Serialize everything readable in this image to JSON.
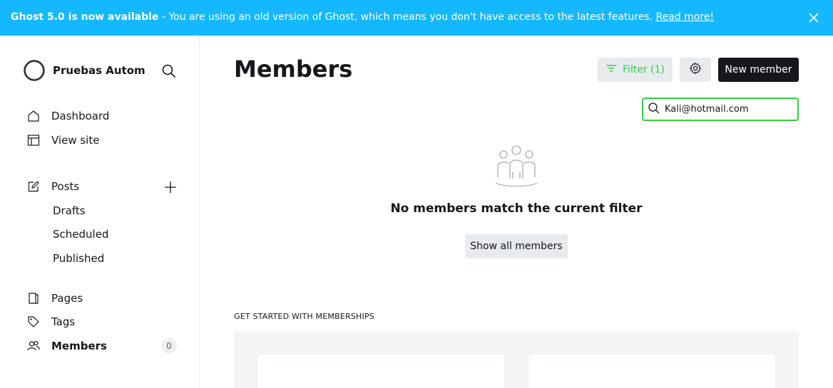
{
  "banner": {
    "bold_text": "Ghost 5.0 is now available",
    "text": " - You are using an old version of Ghost, which means you don't have access to the latest features. ",
    "link_text": "Read more!"
  },
  "sidebar": {
    "site_title": "Pruebas Autom...",
    "nav": {
      "dashboard": "Dashboard",
      "view_site": "View site",
      "posts": "Posts",
      "drafts": "Drafts",
      "scheduled": "Scheduled",
      "published": "Published",
      "pages": "Pages",
      "tags": "Tags",
      "members": "Members",
      "members_count": "0"
    }
  },
  "main": {
    "title": "Members",
    "filter_label": "Filter (1)",
    "new_member_label": "New member",
    "search_value": "Kali@hotmail.com",
    "empty_title": "No members match the current filter",
    "show_all_label": "Show all members",
    "get_started_label": "GET STARTED WITH MEMBERSHIPS"
  },
  "colors": {
    "banner_bg": "#14b8ff",
    "accent_green": "#30cf43",
    "primary_dark": "#15171a"
  },
  "icons": [
    "close-icon",
    "site-logo-icon",
    "search-icon",
    "home-icon",
    "view-site-icon",
    "posts-icon",
    "plus-icon",
    "pages-icon",
    "tag-icon",
    "members-icon",
    "filter-icon",
    "gear-icon",
    "members-group-icon"
  ]
}
